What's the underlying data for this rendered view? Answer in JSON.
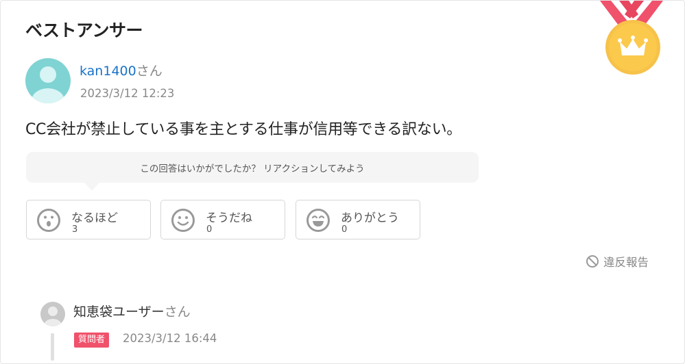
{
  "header": {
    "title": "ベストアンサー"
  },
  "medal": {
    "icon": "crown-medal-icon",
    "ribbon_color": "#f0516b",
    "coin_color": "#f7c24a"
  },
  "answer": {
    "user": {
      "name": "kan1400",
      "suffix": "さん",
      "avatar_color": "#7fd3d3"
    },
    "date": "2023/3/12 12:23",
    "body": "CC会社が禁止している事を主とする仕事が信用等できる訳ない。"
  },
  "reaction": {
    "prompt": "この回答はいかがでしたか？ リアクションしてみよう",
    "buttons": [
      {
        "label": "なるほど",
        "count": "3",
        "icon": "surprised-face-icon"
      },
      {
        "label": "そうだね",
        "count": "0",
        "icon": "smile-face-icon"
      },
      {
        "label": "ありがとう",
        "count": "0",
        "icon": "grin-face-icon"
      }
    ]
  },
  "report": {
    "label": "違反報告",
    "icon": "prohibited-icon"
  },
  "question_reply": {
    "user": {
      "name": "知恵袋ユーザー",
      "suffix": "さん"
    },
    "badge": "質問者",
    "date": "2023/3/12 16:44"
  }
}
